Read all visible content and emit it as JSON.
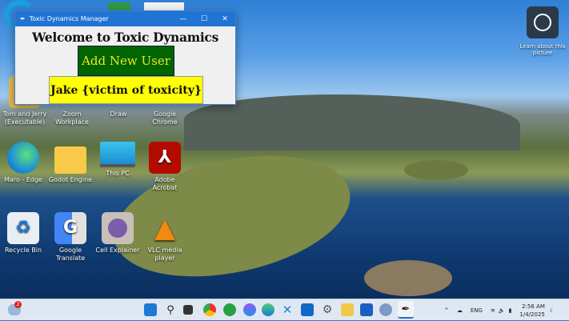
{
  "window": {
    "title": "Toxic Dynamics Manager",
    "heading": "Welcome to Toxic Dynamics Manager",
    "add_user_label": "Add New User",
    "user_label": "Jake {victim of toxicity}",
    "minimize": "—",
    "maximize": "☐",
    "close": "✕",
    "accent": "#1f74d4"
  },
  "desktop": {
    "row1": [
      {
        "label": "Tom and Jerry (Executable)"
      },
      {
        "label": "Zoom Workplace"
      },
      {
        "label": "Draw"
      },
      {
        "label": "Google Chrome"
      }
    ],
    "row2": [
      {
        "label": "Maro - Edge",
        "icon": "edge-icon"
      },
      {
        "label": "Godot Engine",
        "icon": "folder-icon"
      },
      {
        "label": "This PC",
        "icon": "monitor-icon"
      },
      {
        "label": "Adobe Acrobat",
        "icon": "acrobat-icon"
      }
    ],
    "row3": [
      {
        "label": "Recycle Bin",
        "icon": "recycle-bin-icon"
      },
      {
        "label": "Google Translate",
        "icon": "translate-icon"
      },
      {
        "label": "Cell Explainer",
        "icon": "cell-icon"
      },
      {
        "label": "VLC media player",
        "icon": "vlc-icon"
      }
    ],
    "learn_picture": "Learn about this picture"
  },
  "taskbar": {
    "weather_badge": "2",
    "lang": "ENG",
    "time": "2:56 AM",
    "date": "1/4/2025"
  }
}
